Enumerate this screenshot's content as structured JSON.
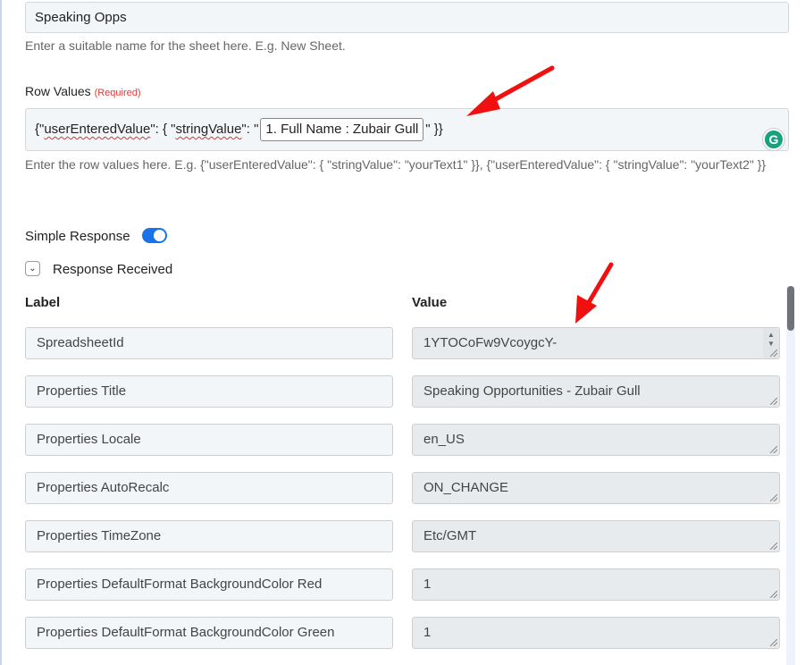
{
  "sheet_name": {
    "value": "Speaking Opps",
    "help": "Enter a suitable name for the sheet here. E.g. New Sheet."
  },
  "row_values": {
    "label": "Row Values",
    "required": "(Required)",
    "prefix_open": "{\"",
    "key1": "userEnteredValue",
    "mid1": "\": { \"",
    "key2": "stringValue",
    "mid2": "\": \"",
    "token": "1. Full Name : Zubair Gull",
    "suffix": "\" }}",
    "help": "Enter the row values here. E.g. {\"userEnteredValue\": { \"stringValue\": \"yourText1\" }}, {\"userEnteredValue\": { \"stringValue\": \"yourText2\" }}",
    "grammarly_letter": "G"
  },
  "simple_response": {
    "label": "Simple Response",
    "enabled": true
  },
  "response_received": {
    "label": "Response Received",
    "expanded": true
  },
  "table": {
    "label_header": "Label",
    "value_header": "Value",
    "rows": [
      {
        "label": "SpreadsheetId",
        "value": "1YTOCoFw9VcoygcY-"
      },
      {
        "label": "Properties Title",
        "value": "Speaking Opportunities - Zubair Gull"
      },
      {
        "label": "Properties Locale",
        "value": "en_US"
      },
      {
        "label": "Properties AutoRecalc",
        "value": "ON_CHANGE"
      },
      {
        "label": "Properties TimeZone",
        "value": "Etc/GMT"
      },
      {
        "label": "Properties DefaultFormat BackgroundColor Red",
        "value": "1"
      },
      {
        "label": "Properties DefaultFormat BackgroundColor Green",
        "value": "1"
      }
    ]
  },
  "colors": {
    "accent": "#1a73e8",
    "required": "#e03b3b",
    "annotation_arrow": "#f01010",
    "grammarly": "#15a37f"
  }
}
